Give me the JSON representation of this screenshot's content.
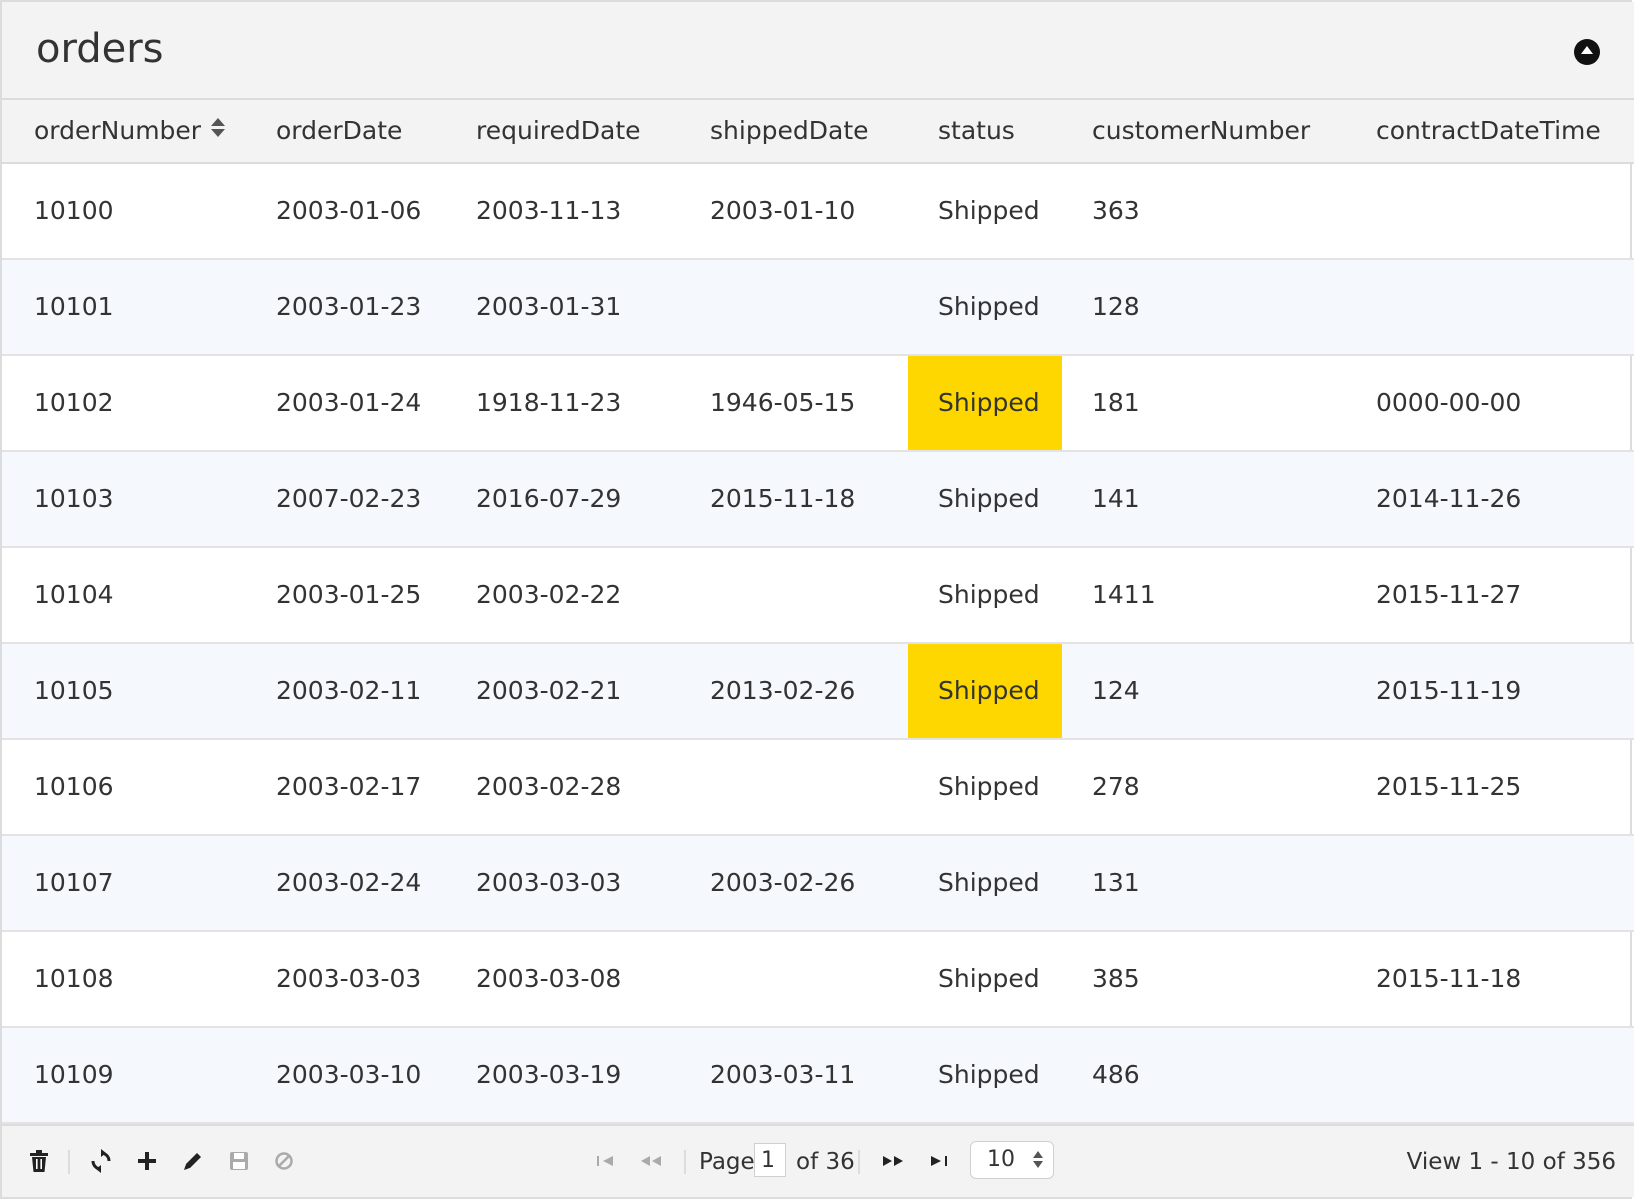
{
  "title": "orders",
  "columns": [
    "orderNumber",
    "orderDate",
    "requiredDate",
    "shippedDate",
    "status",
    "customerNumber",
    "contractDateTime"
  ],
  "sort": {
    "column": "orderNumber"
  },
  "highlight_color": "#ffd700",
  "rows": [
    {
      "orderNumber": "10100",
      "orderDate": "2003-01-06",
      "requiredDate": "2003-11-13",
      "shippedDate": "2003-01-10",
      "status": "Shipped",
      "customerNumber": "363",
      "contractDateTime": "",
      "highlight_status": false
    },
    {
      "orderNumber": "10101",
      "orderDate": "2003-01-23",
      "requiredDate": "2003-01-31",
      "shippedDate": "",
      "status": "Shipped",
      "customerNumber": "128",
      "contractDateTime": "",
      "highlight_status": false
    },
    {
      "orderNumber": "10102",
      "orderDate": "2003-01-24",
      "requiredDate": "1918-11-23",
      "shippedDate": "1946-05-15",
      "status": "Shipped",
      "customerNumber": "181",
      "contractDateTime": "0000-00-00",
      "highlight_status": true
    },
    {
      "orderNumber": "10103",
      "orderDate": "2007-02-23",
      "requiredDate": "2016-07-29",
      "shippedDate": "2015-11-18",
      "status": "Shipped",
      "customerNumber": "141",
      "contractDateTime": "2014-11-26",
      "highlight_status": false
    },
    {
      "orderNumber": "10104",
      "orderDate": "2003-01-25",
      "requiredDate": "2003-02-22",
      "shippedDate": "",
      "status": "Shipped",
      "customerNumber": "1411",
      "contractDateTime": "2015-11-27",
      "highlight_status": false
    },
    {
      "orderNumber": "10105",
      "orderDate": "2003-02-11",
      "requiredDate": "2003-02-21",
      "shippedDate": "2013-02-26",
      "status": "Shipped",
      "customerNumber": "124",
      "contractDateTime": "2015-11-19",
      "highlight_status": true
    },
    {
      "orderNumber": "10106",
      "orderDate": "2003-02-17",
      "requiredDate": "2003-02-28",
      "shippedDate": "",
      "status": "Shipped",
      "customerNumber": "278",
      "contractDateTime": "2015-11-25",
      "highlight_status": false
    },
    {
      "orderNumber": "10107",
      "orderDate": "2003-02-24",
      "requiredDate": "2003-03-03",
      "shippedDate": "2003-02-26",
      "status": "Shipped",
      "customerNumber": "131",
      "contractDateTime": "",
      "highlight_status": false
    },
    {
      "orderNumber": "10108",
      "orderDate": "2003-03-03",
      "requiredDate": "2003-03-08",
      "shippedDate": "",
      "status": "Shipped",
      "customerNumber": "385",
      "contractDateTime": "2015-11-18",
      "highlight_status": false
    },
    {
      "orderNumber": "10109",
      "orderDate": "2003-03-10",
      "requiredDate": "2003-03-19",
      "shippedDate": "2003-03-11",
      "status": "Shipped",
      "customerNumber": "486",
      "contractDateTime": "",
      "highlight_status": false
    }
  ],
  "toolbar": {
    "icons": [
      "trash-icon",
      "refresh-icon",
      "add-icon",
      "edit-icon",
      "save-icon",
      "cancel-icon"
    ]
  },
  "pager": {
    "page_label": "Page",
    "page_value": "1",
    "of_label": "of 36",
    "rows_per_page": "10",
    "view_text": "View 1 - 10 of 356"
  }
}
